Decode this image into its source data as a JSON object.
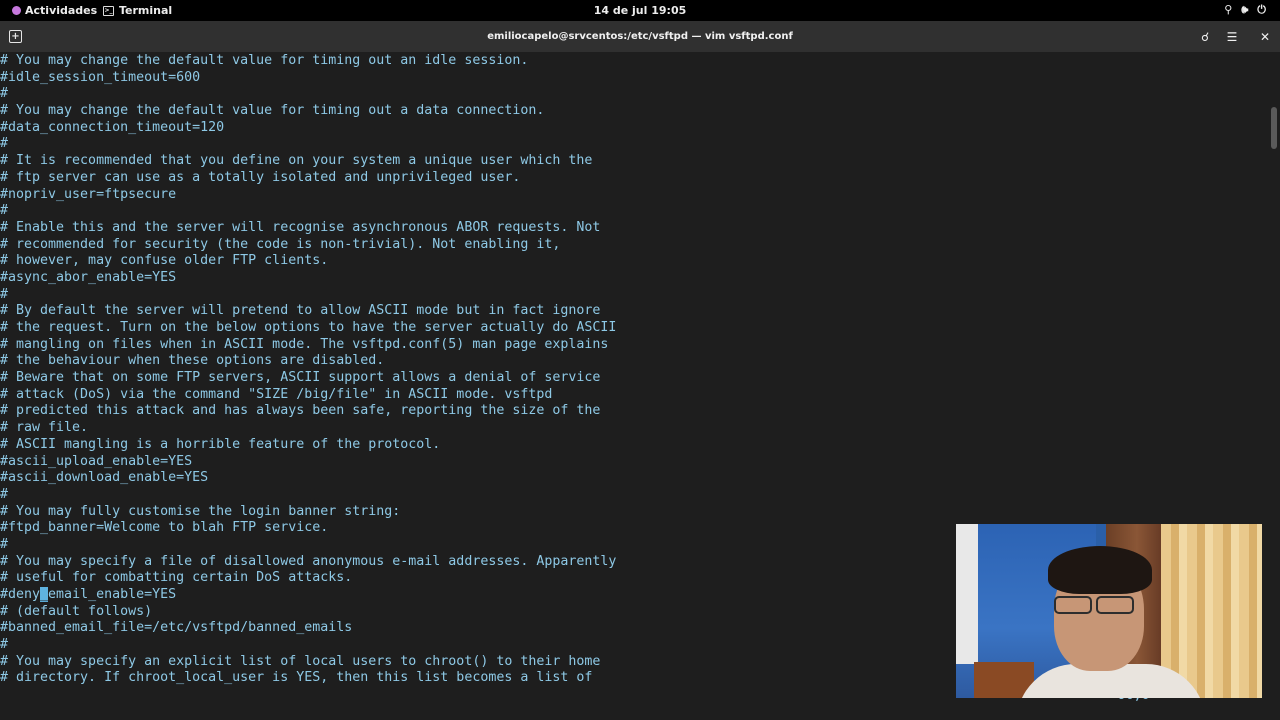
{
  "topbar": {
    "activities": "Actividades",
    "app_name": "Terminal",
    "clock": "14 de jul  19:05",
    "tray": {
      "network_icon": "network-icon",
      "volume_icon": "volume-icon",
      "power_icon": "power-icon"
    }
  },
  "window": {
    "title": "emiliocapelo@srvcentos:/etc/vsftpd — vim vsftpd.conf",
    "new_tab_icon": "new-tab-icon",
    "search_icon": "search-icon",
    "menu_icon": "hamburger-menu-icon",
    "close_icon": "close-icon"
  },
  "terminal": {
    "lines": [
      "# You may change the default value for timing out an idle session.",
      "#idle_session_timeout=600",
      "#",
      "# You may change the default value for timing out a data connection.",
      "#data_connection_timeout=120",
      "#",
      "# It is recommended that you define on your system a unique user which the",
      "# ftp server can use as a totally isolated and unprivileged user.",
      "#nopriv_user=ftpsecure",
      "#",
      "# Enable this and the server will recognise asynchronous ABOR requests. Not",
      "# recommended for security (the code is non-trivial). Not enabling it,",
      "# however, may confuse older FTP clients.",
      "#async_abor_enable=YES",
      "#",
      "# By default the server will pretend to allow ASCII mode but in fact ignore",
      "# the request. Turn on the below options to have the server actually do ASCII",
      "# mangling on files when in ASCII mode. The vsftpd.conf(5) man page explains",
      "# the behaviour when these options are disabled.",
      "# Beware that on some FTP servers, ASCII support allows a denial of service",
      "# attack (DoS) via the command \"SIZE /big/file\" in ASCII mode. vsftpd",
      "# predicted this attack and has always been safe, reporting the size of the",
      "# raw file.",
      "# ASCII mangling is a horrible feature of the protocol.",
      "#ascii_upload_enable=YES",
      "#ascii_download_enable=YES",
      "#",
      "# You may fully customise the login banner string:",
      "#ftpd_banner=Welcome to blah FTP service.",
      "#",
      "# You may specify a file of disallowed anonymous e-mail addresses. Apparently",
      "# useful for combatting certain DoS attacks.",
      "#deny_email_enable=YES",
      "# (default follows)",
      "#banned_email_file=/etc/vsftpd/banned_emails",
      "#",
      "# You may specify an explicit list of local users to chroot() to their home",
      "# directory. If chroot_local_user is YES, then this list becomes a list of"
    ],
    "cursor": {
      "line_index": 32,
      "before": "#deny",
      "char": "_",
      "after": "email_enable=YES"
    },
    "status_ghost": "96,6"
  },
  "colors": {
    "terminal_bg": "#1e1e1e",
    "terminal_fg": "#8ec9e6",
    "titlebar_bg": "#303030",
    "topbar_bg": "#000000"
  }
}
